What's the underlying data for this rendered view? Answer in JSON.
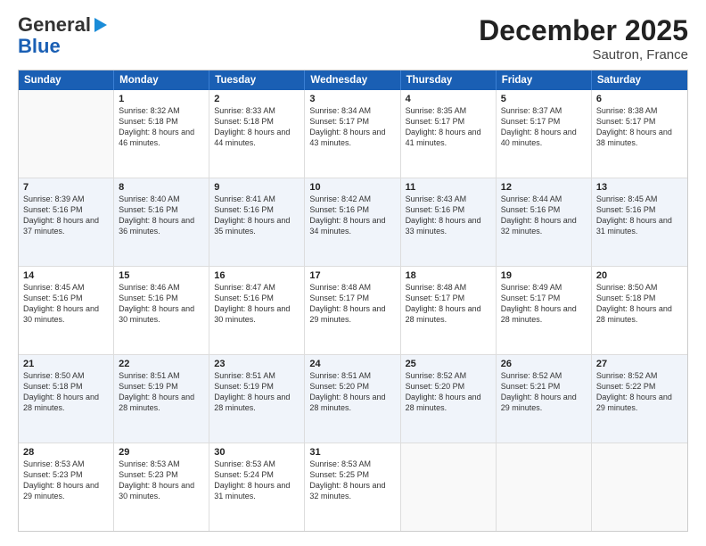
{
  "header": {
    "logo_line1": "General",
    "logo_line2": "Blue",
    "month": "December 2025",
    "location": "Sautron, France"
  },
  "days_of_week": [
    "Sunday",
    "Monday",
    "Tuesday",
    "Wednesday",
    "Thursday",
    "Friday",
    "Saturday"
  ],
  "rows": [
    [
      {
        "day": "",
        "sunrise": "",
        "sunset": "",
        "daylight": ""
      },
      {
        "day": "1",
        "sunrise": "Sunrise: 8:32 AM",
        "sunset": "Sunset: 5:18 PM",
        "daylight": "Daylight: 8 hours and 46 minutes."
      },
      {
        "day": "2",
        "sunrise": "Sunrise: 8:33 AM",
        "sunset": "Sunset: 5:18 PM",
        "daylight": "Daylight: 8 hours and 44 minutes."
      },
      {
        "day": "3",
        "sunrise": "Sunrise: 8:34 AM",
        "sunset": "Sunset: 5:17 PM",
        "daylight": "Daylight: 8 hours and 43 minutes."
      },
      {
        "day": "4",
        "sunrise": "Sunrise: 8:35 AM",
        "sunset": "Sunset: 5:17 PM",
        "daylight": "Daylight: 8 hours and 41 minutes."
      },
      {
        "day": "5",
        "sunrise": "Sunrise: 8:37 AM",
        "sunset": "Sunset: 5:17 PM",
        "daylight": "Daylight: 8 hours and 40 minutes."
      },
      {
        "day": "6",
        "sunrise": "Sunrise: 8:38 AM",
        "sunset": "Sunset: 5:17 PM",
        "daylight": "Daylight: 8 hours and 38 minutes."
      }
    ],
    [
      {
        "day": "7",
        "sunrise": "Sunrise: 8:39 AM",
        "sunset": "Sunset: 5:16 PM",
        "daylight": "Daylight: 8 hours and 37 minutes."
      },
      {
        "day": "8",
        "sunrise": "Sunrise: 8:40 AM",
        "sunset": "Sunset: 5:16 PM",
        "daylight": "Daylight: 8 hours and 36 minutes."
      },
      {
        "day": "9",
        "sunrise": "Sunrise: 8:41 AM",
        "sunset": "Sunset: 5:16 PM",
        "daylight": "Daylight: 8 hours and 35 minutes."
      },
      {
        "day": "10",
        "sunrise": "Sunrise: 8:42 AM",
        "sunset": "Sunset: 5:16 PM",
        "daylight": "Daylight: 8 hours and 34 minutes."
      },
      {
        "day": "11",
        "sunrise": "Sunrise: 8:43 AM",
        "sunset": "Sunset: 5:16 PM",
        "daylight": "Daylight: 8 hours and 33 minutes."
      },
      {
        "day": "12",
        "sunrise": "Sunrise: 8:44 AM",
        "sunset": "Sunset: 5:16 PM",
        "daylight": "Daylight: 8 hours and 32 minutes."
      },
      {
        "day": "13",
        "sunrise": "Sunrise: 8:45 AM",
        "sunset": "Sunset: 5:16 PM",
        "daylight": "Daylight: 8 hours and 31 minutes."
      }
    ],
    [
      {
        "day": "14",
        "sunrise": "Sunrise: 8:45 AM",
        "sunset": "Sunset: 5:16 PM",
        "daylight": "Daylight: 8 hours and 30 minutes."
      },
      {
        "day": "15",
        "sunrise": "Sunrise: 8:46 AM",
        "sunset": "Sunset: 5:16 PM",
        "daylight": "Daylight: 8 hours and 30 minutes."
      },
      {
        "day": "16",
        "sunrise": "Sunrise: 8:47 AM",
        "sunset": "Sunset: 5:16 PM",
        "daylight": "Daylight: 8 hours and 30 minutes."
      },
      {
        "day": "17",
        "sunrise": "Sunrise: 8:48 AM",
        "sunset": "Sunset: 5:17 PM",
        "daylight": "Daylight: 8 hours and 29 minutes."
      },
      {
        "day": "18",
        "sunrise": "Sunrise: 8:48 AM",
        "sunset": "Sunset: 5:17 PM",
        "daylight": "Daylight: 8 hours and 28 minutes."
      },
      {
        "day": "19",
        "sunrise": "Sunrise: 8:49 AM",
        "sunset": "Sunset: 5:17 PM",
        "daylight": "Daylight: 8 hours and 28 minutes."
      },
      {
        "day": "20",
        "sunrise": "Sunrise: 8:50 AM",
        "sunset": "Sunset: 5:18 PM",
        "daylight": "Daylight: 8 hours and 28 minutes."
      }
    ],
    [
      {
        "day": "21",
        "sunrise": "Sunrise: 8:50 AM",
        "sunset": "Sunset: 5:18 PM",
        "daylight": "Daylight: 8 hours and 28 minutes."
      },
      {
        "day": "22",
        "sunrise": "Sunrise: 8:51 AM",
        "sunset": "Sunset: 5:19 PM",
        "daylight": "Daylight: 8 hours and 28 minutes."
      },
      {
        "day": "23",
        "sunrise": "Sunrise: 8:51 AM",
        "sunset": "Sunset: 5:19 PM",
        "daylight": "Daylight: 8 hours and 28 minutes."
      },
      {
        "day": "24",
        "sunrise": "Sunrise: 8:51 AM",
        "sunset": "Sunset: 5:20 PM",
        "daylight": "Daylight: 8 hours and 28 minutes."
      },
      {
        "day": "25",
        "sunrise": "Sunrise: 8:52 AM",
        "sunset": "Sunset: 5:20 PM",
        "daylight": "Daylight: 8 hours and 28 minutes."
      },
      {
        "day": "26",
        "sunrise": "Sunrise: 8:52 AM",
        "sunset": "Sunset: 5:21 PM",
        "daylight": "Daylight: 8 hours and 29 minutes."
      },
      {
        "day": "27",
        "sunrise": "Sunrise: 8:52 AM",
        "sunset": "Sunset: 5:22 PM",
        "daylight": "Daylight: 8 hours and 29 minutes."
      }
    ],
    [
      {
        "day": "28",
        "sunrise": "Sunrise: 8:53 AM",
        "sunset": "Sunset: 5:23 PM",
        "daylight": "Daylight: 8 hours and 29 minutes."
      },
      {
        "day": "29",
        "sunrise": "Sunrise: 8:53 AM",
        "sunset": "Sunset: 5:23 PM",
        "daylight": "Daylight: 8 hours and 30 minutes."
      },
      {
        "day": "30",
        "sunrise": "Sunrise: 8:53 AM",
        "sunset": "Sunset: 5:24 PM",
        "daylight": "Daylight: 8 hours and 31 minutes."
      },
      {
        "day": "31",
        "sunrise": "Sunrise: 8:53 AM",
        "sunset": "Sunset: 5:25 PM",
        "daylight": "Daylight: 8 hours and 32 minutes."
      },
      {
        "day": "",
        "sunrise": "",
        "sunset": "",
        "daylight": ""
      },
      {
        "day": "",
        "sunrise": "",
        "sunset": "",
        "daylight": ""
      },
      {
        "day": "",
        "sunrise": "",
        "sunset": "",
        "daylight": ""
      }
    ]
  ]
}
